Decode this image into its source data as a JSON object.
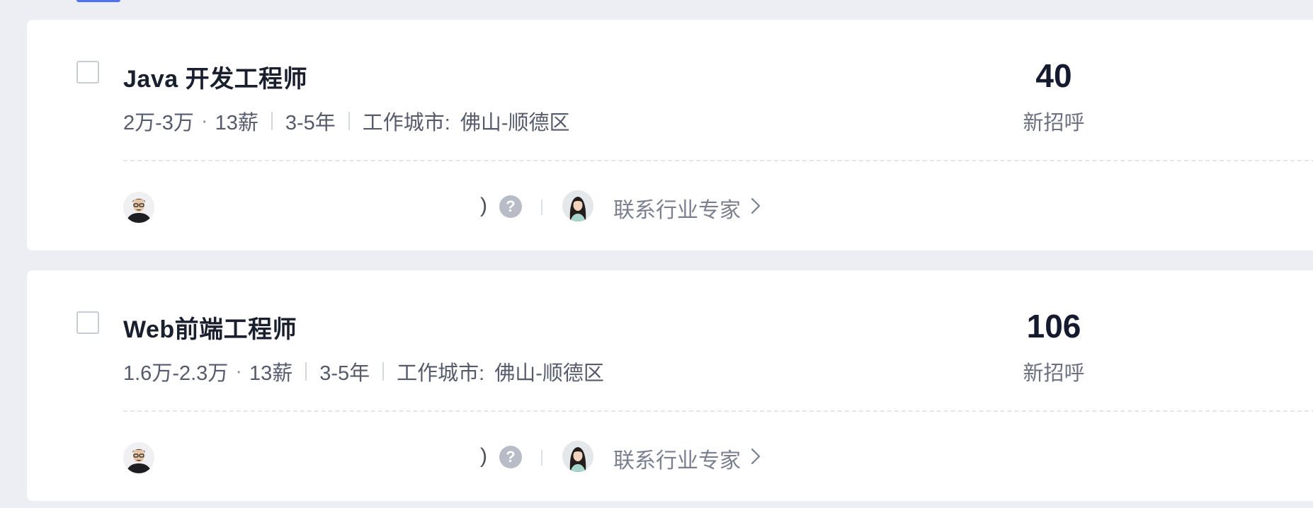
{
  "jobs": [
    {
      "title": "Java 开发工程师",
      "salary": "2万-3万",
      "bonus": "13薪",
      "experience": "3-5年",
      "city_label": "工作城市:",
      "city": "佛山-顺德区",
      "stat_value": "40",
      "stat_label": "新招呼",
      "paren": ")",
      "help_glyph": "?",
      "expert_link": "联系行业专家"
    },
    {
      "title": "Web前端工程师",
      "salary": "1.6万-2.3万",
      "bonus": "13薪",
      "experience": "3-5年",
      "city_label": "工作城市:",
      "city": "佛山-顺德区",
      "stat_value": "106",
      "stat_label": "新招呼",
      "paren": ")",
      "help_glyph": "?",
      "expert_link": "联系行业专家"
    }
  ],
  "meta_dot": "·",
  "colors": {
    "accent": "#4f73f0",
    "background": "#eceef3",
    "card": "#ffffff",
    "title": "#1a1f2e",
    "help_icon": "#b8bcc6"
  },
  "icons": {
    "checkbox": "checkbox-icon",
    "help": "question-circle-icon",
    "chevron": "chevron-right-icon",
    "recruiter_avatar": "avatar-male",
    "expert_avatar": "avatar-female"
  }
}
